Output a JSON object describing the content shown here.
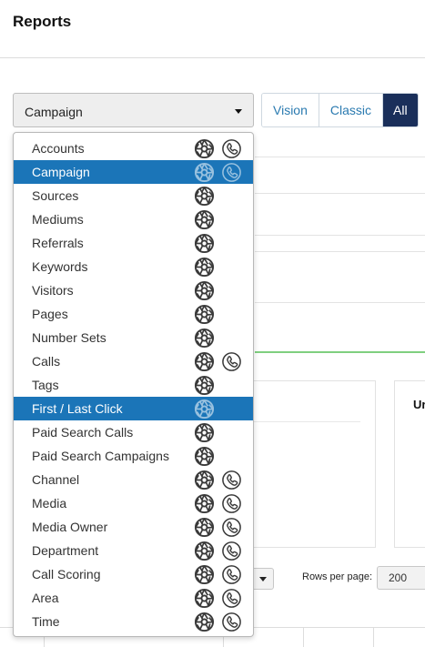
{
  "page": {
    "title": "Reports"
  },
  "report_select": {
    "value": "Campaign"
  },
  "view_toggle": {
    "buttons": [
      "Vision",
      "Classic",
      "All"
    ],
    "active": "All"
  },
  "dropdown": {
    "options": [
      {
        "label": "Accounts",
        "icons": [
          "tracking-icon",
          "phone-icon"
        ],
        "highlighted": false
      },
      {
        "label": "Campaign",
        "icons": [
          "tracking-icon",
          "phone-icon"
        ],
        "highlighted": true
      },
      {
        "label": "Sources",
        "icons": [
          "tracking-icon"
        ],
        "highlighted": false
      },
      {
        "label": "Mediums",
        "icons": [
          "tracking-icon"
        ],
        "highlighted": false
      },
      {
        "label": "Referrals",
        "icons": [
          "tracking-icon"
        ],
        "highlighted": false
      },
      {
        "label": "Keywords",
        "icons": [
          "tracking-icon"
        ],
        "highlighted": false
      },
      {
        "label": "Visitors",
        "icons": [
          "tracking-icon"
        ],
        "highlighted": false
      },
      {
        "label": "Pages",
        "icons": [
          "tracking-icon"
        ],
        "highlighted": false
      },
      {
        "label": "Number Sets",
        "icons": [
          "tracking-icon"
        ],
        "highlighted": false
      },
      {
        "label": "Calls",
        "icons": [
          "tracking-icon",
          "phone-icon"
        ],
        "highlighted": false
      },
      {
        "label": "Tags",
        "icons": [
          "tracking-icon"
        ],
        "highlighted": false
      },
      {
        "label": "First / Last Click",
        "icons": [
          "tracking-icon"
        ],
        "highlighted": true
      },
      {
        "label": "Paid Search Calls",
        "icons": [
          "tracking-icon"
        ],
        "highlighted": false
      },
      {
        "label": "Paid Search Campaigns",
        "icons": [
          "tracking-icon"
        ],
        "highlighted": false
      },
      {
        "label": "Channel",
        "icons": [
          "tracking-icon",
          "phone-icon"
        ],
        "highlighted": false
      },
      {
        "label": "Media",
        "icons": [
          "tracking-icon",
          "phone-icon"
        ],
        "highlighted": false
      },
      {
        "label": "Media Owner",
        "icons": [
          "tracking-icon",
          "phone-icon"
        ],
        "highlighted": false
      },
      {
        "label": "Department",
        "icons": [
          "tracking-icon",
          "phone-icon"
        ],
        "highlighted": false
      },
      {
        "label": "Call Scoring",
        "icons": [
          "tracking-icon",
          "phone-icon"
        ],
        "highlighted": false
      },
      {
        "label": "Area",
        "icons": [
          "tracking-icon",
          "phone-icon"
        ],
        "highlighted": false
      },
      {
        "label": "Time",
        "icons": [
          "tracking-icon",
          "phone-icon"
        ],
        "highlighted": false
      }
    ]
  },
  "background": {
    "panel_right_title": "Ur",
    "rows_per_page_label": "Rows per page:",
    "rows_per_page_value": "200"
  },
  "colors": {
    "highlight": "#1b75b8",
    "toggle_active": "#1a2f5a",
    "toggle_text": "#2a7ab0",
    "chart_line": "#7fcf7f"
  }
}
